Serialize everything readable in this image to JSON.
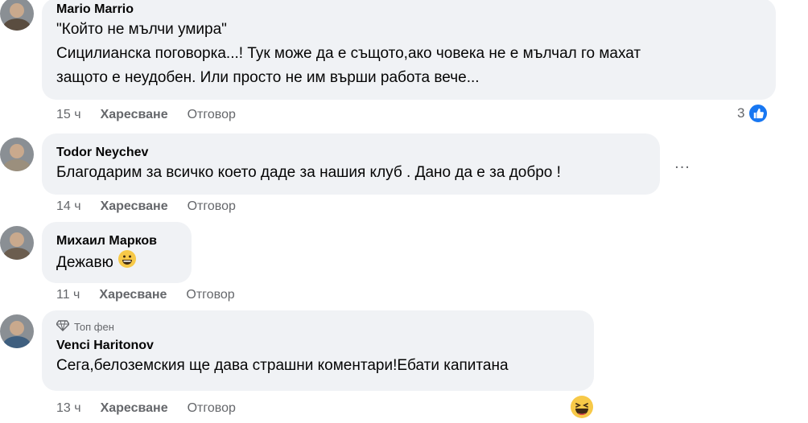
{
  "comments": [
    {
      "author": "Mario Marrio",
      "lines": [
        "\"Който не мълчи умира\"",
        "Сицилианска поговорка...! Тук може да е същото,ако човека не е мълчал го махат",
        "защото е неудобен. Или просто не им върши работа вече..."
      ],
      "time": "15 ч",
      "like_label": "Харесване",
      "reply_label": "Отговор",
      "reaction_count": "3",
      "reaction_icon": "like-icon"
    },
    {
      "author": "Todor Neychev",
      "lines": [
        "Благодарим за всичко което даде за нашия клуб . Дано да е за добро !"
      ],
      "time": "14 ч",
      "like_label": "Харесване",
      "reply_label": "Отговор",
      "more_label": "..."
    },
    {
      "author": "Михаил Марков",
      "lines": [
        "Дежавю"
      ],
      "time": "11 ч",
      "like_label": "Харесване",
      "reply_label": "Отговор",
      "inline_emoji": "grinning-face-icon"
    },
    {
      "badge": "Топ фен",
      "badge_icon": "diamond-icon",
      "author": "Venci Haritonov",
      "lines": [
        "Сега,белоземския ще дава страшни коментари!Ебати капитана"
      ],
      "time": "13 ч",
      "like_label": "Харесване",
      "reply_label": "Отговор",
      "reaction_icon": "laughing-face-icon"
    }
  ],
  "colors": {
    "bubble": "#f0f2f5",
    "meta": "#65676b",
    "like_blue": "#1877f2",
    "text": "#050505"
  }
}
